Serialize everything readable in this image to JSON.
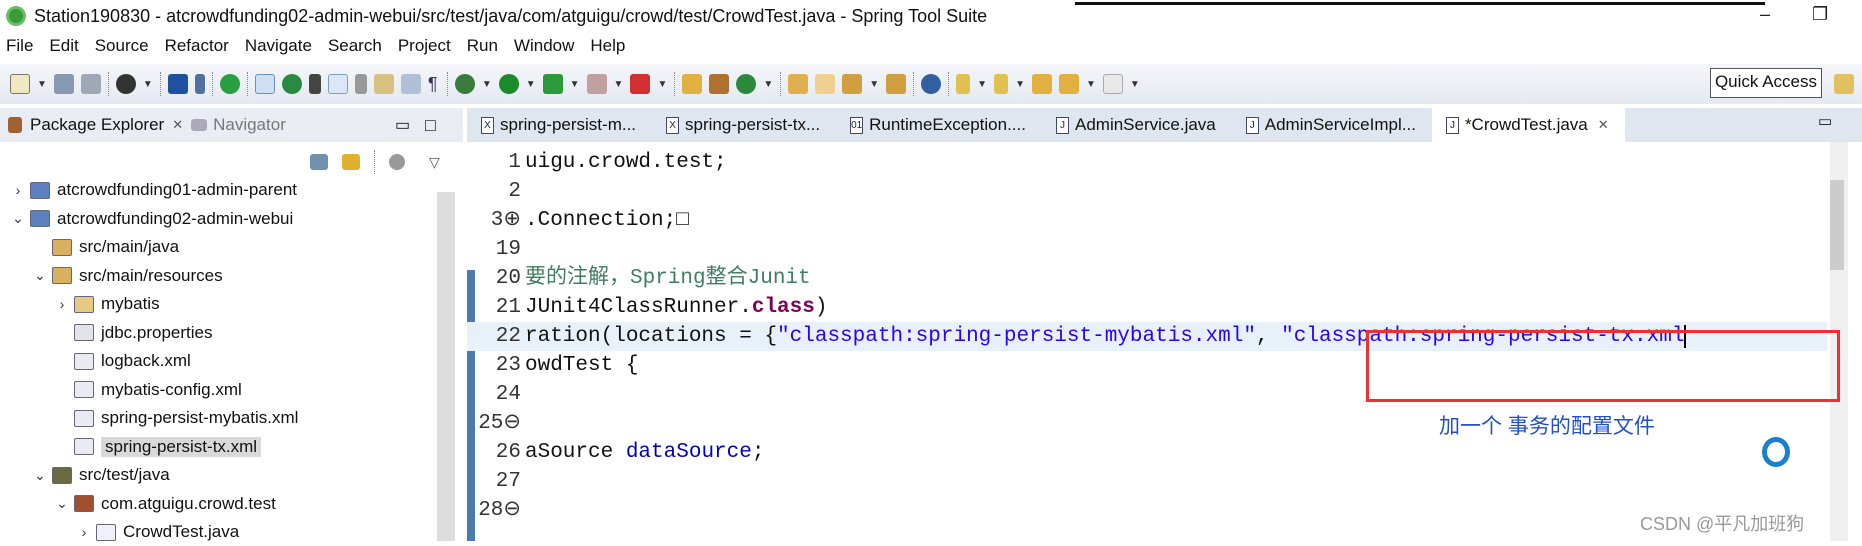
{
  "window": {
    "title": "Station190830 - atcrowdfunding02-admin-webui/src/test/java/com/atguigu/crowd/test/CrowdTest.java - Spring Tool Suite",
    "minimize": "–",
    "restore": "❐"
  },
  "menu": [
    "File",
    "Edit",
    "Source",
    "Refactor",
    "Navigate",
    "Search",
    "Project",
    "Run",
    "Window",
    "Help"
  ],
  "toolbar": {
    "quick_access": "Quick Access"
  },
  "left_panel": {
    "tabs": [
      {
        "label": "Package Explorer",
        "close": "✕"
      },
      {
        "label": "Navigator"
      }
    ],
    "minimize": "▭",
    "maximize": "□"
  },
  "tree": [
    {
      "label": "atcrowdfunding01-admin-parent",
      "chevron": "›",
      "icon": "maven-project-icon"
    },
    {
      "label": "atcrowdfunding02-admin-webui",
      "chevron": "⌄",
      "icon": "spring-maven-project-icon"
    },
    {
      "label": "src/main/java",
      "chevron": "",
      "icon": "source-folder-icon"
    },
    {
      "label": "src/main/resources",
      "chevron": "⌄",
      "icon": "source-folder-icon"
    },
    {
      "label": "mybatis",
      "chevron": "›",
      "icon": "folder-icon"
    },
    {
      "label": "jdbc.properties",
      "chevron": "",
      "icon": "properties-file-icon"
    },
    {
      "label": "logback.xml",
      "chevron": "",
      "icon": "xml-file-icon"
    },
    {
      "label": "mybatis-config.xml",
      "chevron": "",
      "icon": "xml-file-icon"
    },
    {
      "label": "spring-persist-mybatis.xml",
      "chevron": "",
      "icon": "spring-xml-icon"
    },
    {
      "label": "spring-persist-tx.xml",
      "chevron": "",
      "icon": "spring-xml-icon",
      "selected": true
    },
    {
      "label": "src/test/java",
      "chevron": "⌄",
      "icon": "test-source-folder-icon"
    },
    {
      "label": "com.atguigu.crowd.test",
      "chevron": "⌄",
      "icon": "package-icon"
    },
    {
      "label": "CrowdTest.java",
      "chevron": "›",
      "icon": "java-file-icon"
    }
  ],
  "editor": {
    "tabs": [
      {
        "label": "spring-persist-m...",
        "icon": "X"
      },
      {
        "label": "spring-persist-tx...",
        "icon": "X"
      },
      {
        "label": "RuntimeException....",
        "icon": "01"
      },
      {
        "label": "AdminService.java",
        "icon": "J"
      },
      {
        "label": "AdminServiceImpl...",
        "icon": "J"
      },
      {
        "label": "*CrowdTest.java",
        "icon": "J",
        "active": true,
        "close": "✕"
      }
    ],
    "lines": [
      {
        "n": "1",
        "parts": [
          {
            "t": "uigu.crowd.test;"
          }
        ]
      },
      {
        "n": "2",
        "parts": []
      },
      {
        "n": "3⊕",
        "parts": [
          {
            "t": ".Connection;□"
          }
        ]
      },
      {
        "n": "19",
        "parts": []
      },
      {
        "n": "20",
        "parts": [
          {
            "t": "要的注解，Spring整合Junit",
            "c": "cm"
          }
        ]
      },
      {
        "n": "21",
        "parts": [
          {
            "t": "JUnit4ClassRunner."
          },
          {
            "t": "class",
            "c": "kw"
          },
          {
            "t": ")"
          }
        ]
      },
      {
        "n": "22",
        "hl": true,
        "parts": [
          {
            "t": "ration(locations = {"
          },
          {
            "t": "\"classpath:spring-persist-mybatis.xml\"",
            "c": "str"
          },
          {
            "t": ", "
          },
          {
            "t": "\"classpath:spring-persist-tx.xml",
            "c": "str"
          }
        ]
      },
      {
        "n": "23",
        "parts": [
          {
            "t": "owdTest {"
          }
        ]
      },
      {
        "n": "24",
        "parts": []
      },
      {
        "n": "25⊖",
        "parts": []
      },
      {
        "n": "26",
        "parts": [
          {
            "t": "aSource "
          },
          {
            "t": "dataSource",
            "c": "fld"
          },
          {
            "t": ";"
          }
        ]
      },
      {
        "n": "27",
        "parts": []
      },
      {
        "n": "28⊖",
        "parts": []
      }
    ]
  },
  "annotation": {
    "note": "加一个  事务的配置文件",
    "box_color": "#f03030"
  },
  "watermark": "CSDN @平凡加班狗"
}
